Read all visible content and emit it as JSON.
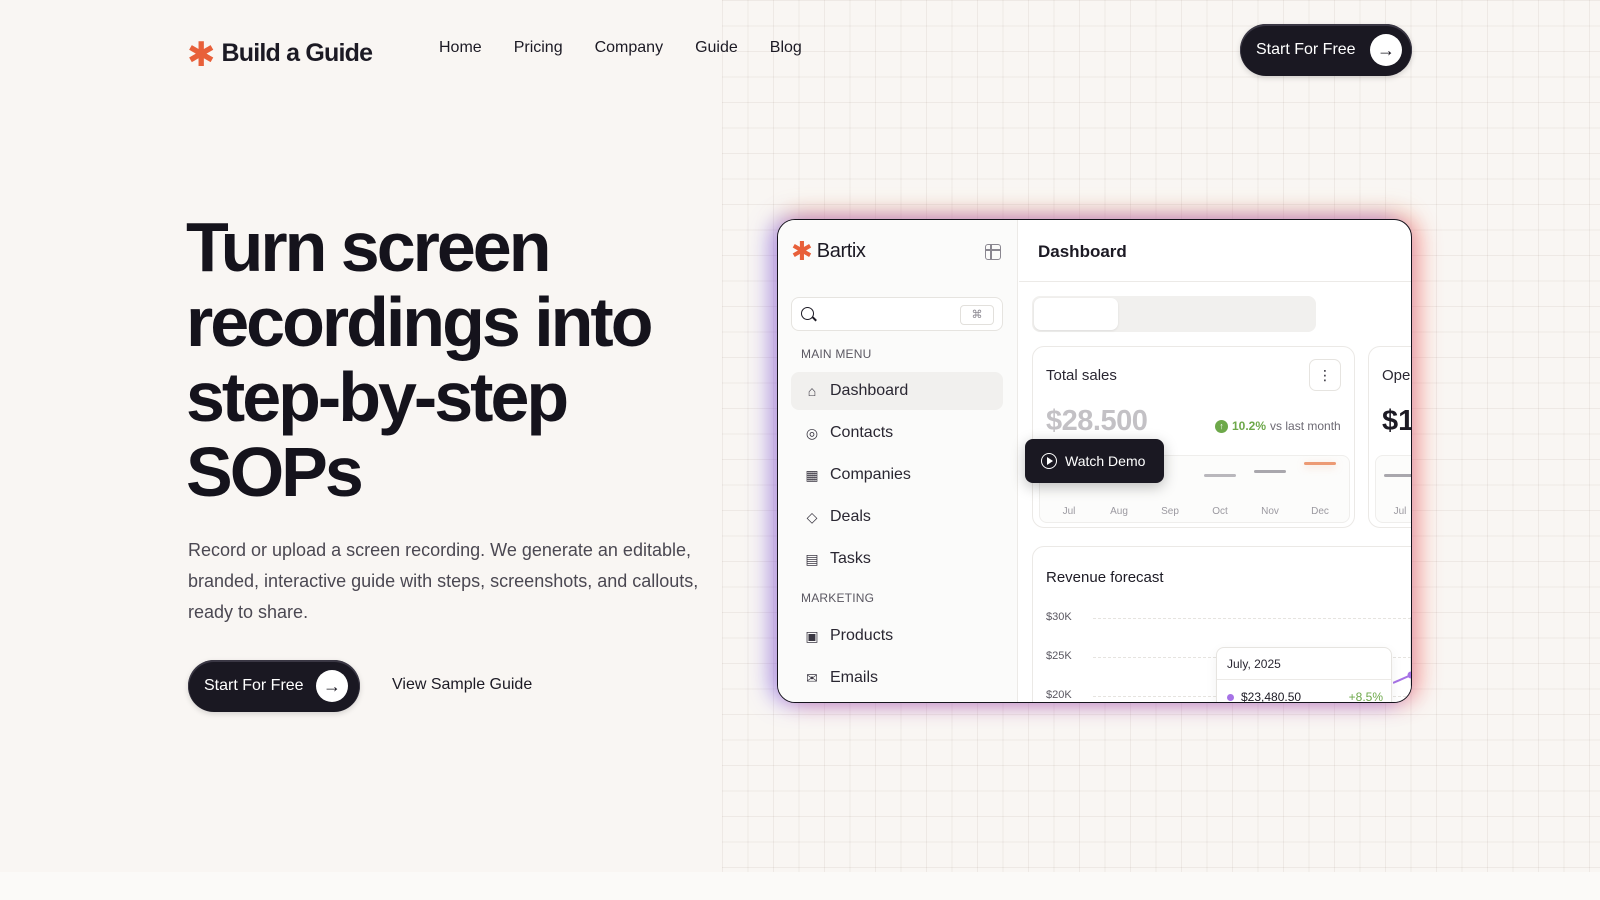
{
  "brand": {
    "name": "Build a Guide",
    "accent": "#e8603a"
  },
  "nav": {
    "links": [
      "Home",
      "Pricing",
      "Company",
      "Guide",
      "Blog"
    ],
    "cta_label": "Start For Free"
  },
  "hero": {
    "title_lines": [
      "Turn screen",
      "recordings into",
      "step-by-step",
      "SOPs"
    ],
    "subtitle": "Record or upload a screen recording. We generate an editable, branded, interactive guide with steps, screenshots, and callouts, ready to share.",
    "cta_label": "Start For Free",
    "secondary_label": "View Sample Guide"
  },
  "preview": {
    "app_name": "Bartix",
    "search_shortcut": "⌘",
    "sections": {
      "main_menu": "MAIN MENU",
      "marketing": "MARKETING"
    },
    "main_menu_items": [
      {
        "label": "Dashboard",
        "icon": "home-icon",
        "active": true
      },
      {
        "label": "Contacts",
        "icon": "user-circle-icon"
      },
      {
        "label": "Companies",
        "icon": "building-icon"
      },
      {
        "label": "Deals",
        "icon": "tag-icon"
      },
      {
        "label": "Tasks",
        "icon": "clipboard-icon"
      }
    ],
    "marketing_items": [
      {
        "label": "Products",
        "icon": "calendar-icon"
      },
      {
        "label": "Emails",
        "icon": "mail-open-icon"
      }
    ],
    "page_title": "Dashboard",
    "total_sales": {
      "title": "Total sales",
      "value": "$28.500",
      "change": "10.2%",
      "change_note": "vs last month",
      "months": [
        "Jul",
        "Aug",
        "Sep",
        "Oct",
        "Nov",
        "Dec"
      ]
    },
    "open_card": {
      "title": "Ope",
      "value": "$1",
      "month": "Jul"
    },
    "revenue": {
      "title": "Revenue forecast",
      "y_ticks": [
        "$30K",
        "$25K",
        "$20K"
      ],
      "tooltip": {
        "date": "July, 2025",
        "value": "$23,480.50",
        "change": "+8.5%"
      }
    },
    "watch_demo_label": "Watch Demo"
  }
}
